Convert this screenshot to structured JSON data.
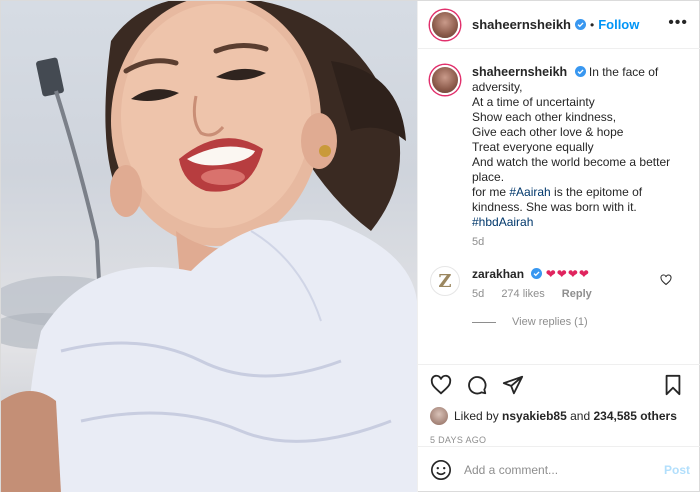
{
  "photo": {
    "alt": ""
  },
  "header": {
    "username": "shaheernsheikh",
    "separator": "•",
    "follow_label": "Follow",
    "more_label": "•••"
  },
  "caption": {
    "username": "shaheernsheikh",
    "lines": [
      "In the face of",
      "adversity,",
      "At a time of uncertainty",
      "Show each other kindness,",
      "Give each other love & hope",
      "Treat everyone equally",
      "And watch the world become a better",
      "place."
    ],
    "for_me_prefix": "for me ",
    "mention_tag": "#Aairah",
    "for_me_suffix": " is the epitome of",
    "kindness_line": "kindness. She was born with it.",
    "hashtag": "#hbdAairah",
    "age": "5d"
  },
  "comment": {
    "avatar_letter": "Z",
    "username": "zarakhan",
    "hearts": "❤❤❤❤",
    "age": "5d",
    "likes": "274 likes",
    "reply_label": "Reply",
    "view_replies": "View replies (1)"
  },
  "actions": {
    "liked_by_prefix": "Liked by ",
    "liked_by_user": "nsyakieb85",
    "liked_by_and": " and ",
    "liked_by_others": "234,585 others",
    "timestamp": "5 DAYS AGO"
  },
  "add_comment": {
    "placeholder": "Add a comment...",
    "post_label": "Post"
  },
  "colors": {
    "link": "#00376b",
    "follow": "#0095f6",
    "post_disabled": "#b2dffc",
    "heart": "#e0245e",
    "story_ring": "#e1306c"
  }
}
